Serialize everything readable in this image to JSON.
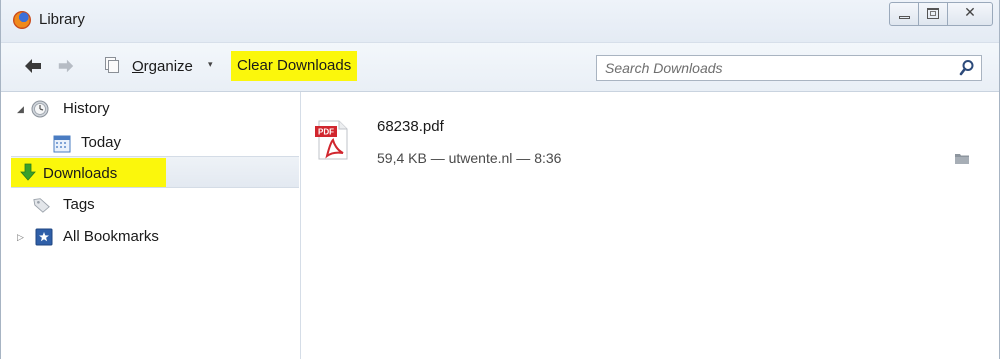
{
  "window": {
    "title": "Library",
    "close_symbol": "✕"
  },
  "toolbar": {
    "organize_prefix": "O",
    "organize_rest": "rganize",
    "organize_caret": "▾",
    "clear_label": "Clear Downloads",
    "back_symbol": "🡐",
    "forward_symbol": "🡒"
  },
  "search": {
    "placeholder": "Search Downloads",
    "value": ""
  },
  "sidebar": {
    "items": [
      {
        "label": "History",
        "icon": "clock-icon",
        "twisty": "◢"
      },
      {
        "label": "Today",
        "icon": "calendar-icon"
      },
      {
        "label": "Downloads",
        "icon": "download-arrow-icon"
      },
      {
        "label": "Tags",
        "icon": "tag-icon"
      },
      {
        "label": "All Bookmarks",
        "icon": "bookmarks-icon",
        "twisty": "▷"
      }
    ]
  },
  "downloads": [
    {
      "name": "68238.pdf",
      "meta": "59,4 KB — utwente.nl — 8:36",
      "icon": "pdf-icon"
    }
  ],
  "colors": {
    "highlight": "#fbf70c",
    "accent": "#3c6fd8",
    "download_green": "#3aa12b"
  }
}
